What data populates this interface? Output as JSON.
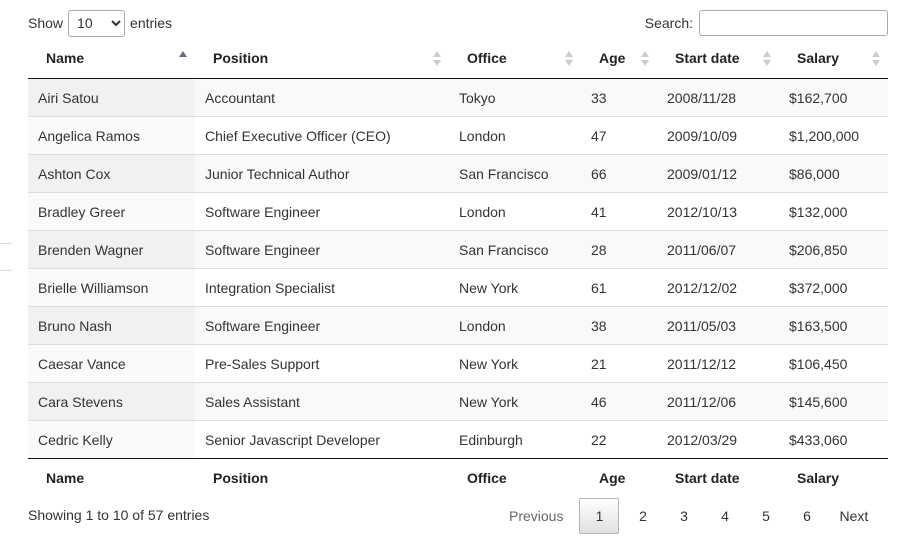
{
  "length_menu": {
    "prefix": "Show",
    "suffix": "entries",
    "selected": "10"
  },
  "search": {
    "label": "Search:",
    "value": ""
  },
  "columns": [
    "Name",
    "Position",
    "Office",
    "Age",
    "Start date",
    "Salary"
  ],
  "rows": [
    [
      "Airi Satou",
      "Accountant",
      "Tokyo",
      "33",
      "2008/11/28",
      "$162,700"
    ],
    [
      "Angelica Ramos",
      "Chief Executive Officer (CEO)",
      "London",
      "47",
      "2009/10/09",
      "$1,200,000"
    ],
    [
      "Ashton Cox",
      "Junior Technical Author",
      "San Francisco",
      "66",
      "2009/01/12",
      "$86,000"
    ],
    [
      "Bradley Greer",
      "Software Engineer",
      "London",
      "41",
      "2012/10/13",
      "$132,000"
    ],
    [
      "Brenden Wagner",
      "Software Engineer",
      "San Francisco",
      "28",
      "2011/06/07",
      "$206,850"
    ],
    [
      "Brielle Williamson",
      "Integration Specialist",
      "New York",
      "61",
      "2012/12/02",
      "$372,000"
    ],
    [
      "Bruno Nash",
      "Software Engineer",
      "London",
      "38",
      "2011/05/03",
      "$163,500"
    ],
    [
      "Caesar Vance",
      "Pre-Sales Support",
      "New York",
      "21",
      "2011/12/12",
      "$106,450"
    ],
    [
      "Cara Stevens",
      "Sales Assistant",
      "New York",
      "46",
      "2011/12/06",
      "$145,600"
    ],
    [
      "Cedric Kelly",
      "Senior Javascript Developer",
      "Edinburgh",
      "22",
      "2012/03/29",
      "$433,060"
    ]
  ],
  "sort": {
    "column": "Name",
    "direction": "ascending"
  },
  "info": "Showing 1 to 10 of 57 entries",
  "pagination": {
    "previous": "Previous",
    "next": "Next",
    "pages": [
      "1",
      "2",
      "3",
      "4",
      "5",
      "6"
    ],
    "current": "1"
  },
  "colors": {
    "sort_active": "#6466a8",
    "row_stripe": "#f9f9f9",
    "border": "#111111"
  }
}
